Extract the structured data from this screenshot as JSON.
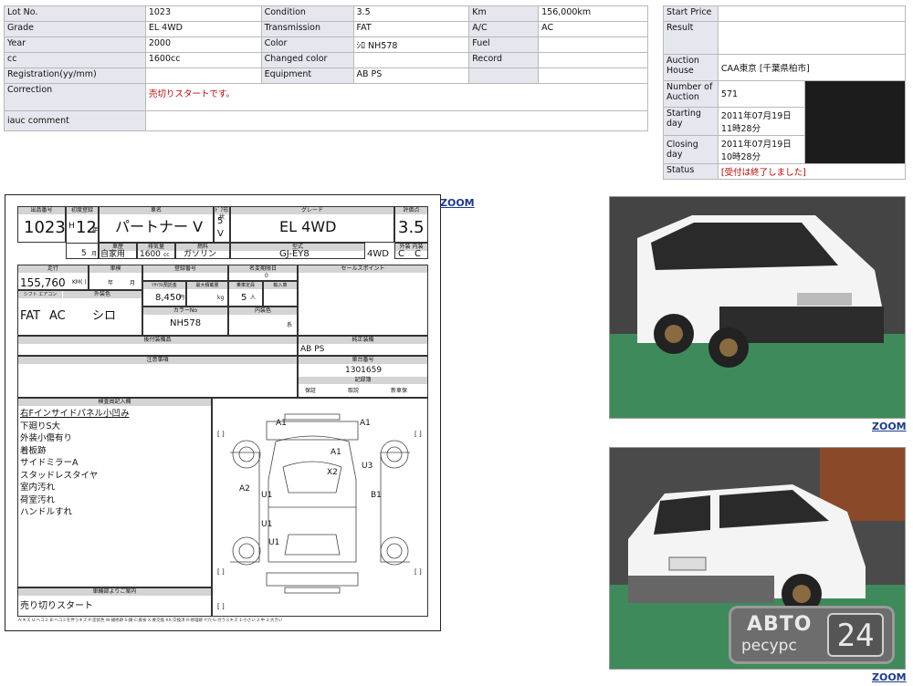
{
  "left_table": {
    "rows": [
      [
        "Lot No.",
        "1023",
        "Condition",
        "3.5",
        "Km",
        "156,000km"
      ],
      [
        "Grade",
        "EL 4WD",
        "Transmission",
        "FAT",
        "A/C",
        "AC"
      ],
      [
        "Year",
        "2000",
        "Color",
        "ｼﾛ NH578",
        "Fuel",
        ""
      ],
      [
        "cc",
        "1600cc",
        "Changed color",
        "",
        "Record",
        ""
      ],
      [
        "Registration(yy/mm)",
        "",
        "Equipment",
        "AB PS",
        "",
        ""
      ]
    ],
    "correction_label": "Correction",
    "correction_value": "売切りスタートです。",
    "comment_label": "iauc comment",
    "comment_value": ""
  },
  "right_table": {
    "start_price_label": "Start Price",
    "result_label": "Result",
    "auction_house_label": "Auction House",
    "auction_house_value": "CAA東京 [千葉県柏市]",
    "number_label": "Number of Auction",
    "number_value": "571",
    "starting_label": "Starting day",
    "starting_value": "2011年07月19日 11時28分",
    "closing_label": "Closing day",
    "closing_value": "2011年07月19日 10時28分",
    "status_label": "Status",
    "status_value": "[受付は終了しました]"
  },
  "zoom_label": "ZOOM",
  "sheet": {
    "hdr": {
      "lot": "出品番号",
      "first_reg": "初度登録",
      "name": "車名",
      "doors": "ﾄﾞｱ形状",
      "grade": "グレード",
      "score": "評価点",
      "use": "車歴",
      "displacement": "排気量",
      "fuel": "燃料",
      "model": "型式",
      "ext_int": "外装 内装",
      "mileage": "走行",
      "inspection": "車検",
      "reg_no": "登録番号",
      "name_change": "名変期限日",
      "sales_point": "セールスポイント",
      "shift": "シフト エアコン",
      "ext_color": "外装色",
      "recycle": "ﾘｻｲｸﾙ預託金",
      "max_load": "最大積載量",
      "capacity": "乗車定員",
      "import": "輸入車",
      "color_no": "カラーNo",
      "int_color": "内装色",
      "optional": "後付装備品",
      "regular": "純正装備",
      "notes": "注意事項",
      "chassis": "車台番号",
      "record": "記録簿",
      "inspector": "検査員記入欄",
      "dealer": "車輛部よりご案内"
    },
    "lot_no": "1023",
    "year_prefix": "H",
    "year": "12",
    "year_suffix": "年",
    "car_name": "パートナー V",
    "doors": "5",
    "doors_type": "V",
    "grade": "EL 4WD",
    "score": "3.5",
    "month": "5",
    "month_suffix": "月",
    "use": "自家用",
    "cc": "1600",
    "cc_unit": "cc",
    "fuel": "ガソリン",
    "model_code": "GJ-EY8",
    "drive": "4WD",
    "ext_grade": "C",
    "int_grade": "C",
    "mileage": "155,760",
    "mileage_unit": "KM( )",
    "insp_year": "年",
    "insp_month": "月",
    "name_change_value": "0",
    "recycle_value": "8,450",
    "recycle_unit": "円",
    "load_unit": "kg",
    "capacity_value": "5",
    "capacity_unit": "人",
    "shift_value": "FAT",
    "ac_value": "AC",
    "color_value": "シロ",
    "color_no": "NH578",
    "int_color_unit": "系",
    "regular_value": "AB PS",
    "chassis_value": "1301659",
    "record_yes": "有",
    "record_no": "無",
    "sub_cells": [
      "保証",
      "取説",
      "新車保"
    ],
    "inspector_notes": [
      "右Fインサイドパネル小凹み",
      "下廻りS大",
      "外装小傷有り",
      "着板跡",
      "サイドミラーA",
      "スタッドレスタイヤ",
      "室内汚れ",
      "荷室汚れ",
      "ハンドルすれ"
    ],
    "dealer_note": "売り切りスタート",
    "diagram_marks": [
      "A1",
      "A1",
      "A1",
      "X2",
      "U3",
      "A2",
      "U1",
      "B1",
      "U1",
      "U1"
    ],
    "brackets": [
      "[  ]",
      "[  ]",
      "[  ]",
      "[  ]",
      "[  ]"
    ],
    "legend": "A:キズ U:ヘコミ B:ヘコミを伴うキズ P:塗装色 W:補修跡 S:錆 C:腐食 X:要交換 XX:交換済 R:修理跡 Y:穴 G:ガラスキズ 1:小さい 2:中 3:大きい"
  },
  "logo": {
    "line1": "АВТО",
    "line2": "ресурс",
    "digits": "24"
  }
}
